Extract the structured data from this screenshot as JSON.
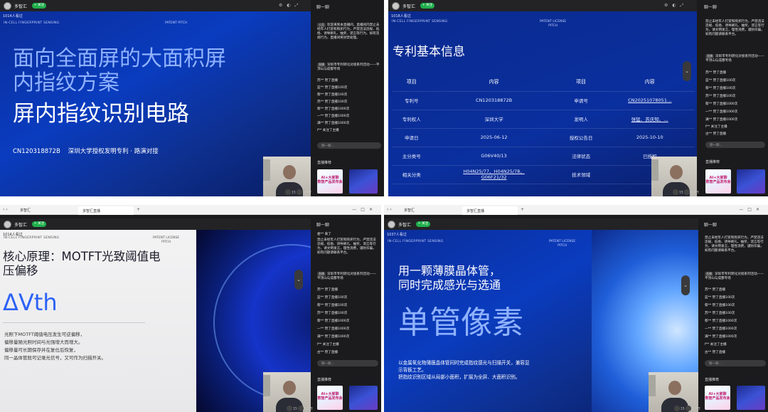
{
  "p1": {
    "streamer": "多智汇",
    "follow": "+ 关注",
    "viewers": "1014人看过",
    "tag_left": "IN-CELL FINGERPRINT SENSING",
    "tag_right": "PATENT PITCH",
    "title_line1": "面向全面屏的大面积屏",
    "title_line2": "内指纹方案",
    "title_line3": "屏内指纹识别电路",
    "footer": "CN120318872B    深圳大学授权发明专利 · 路演对接",
    "chat_header": "聊一聊",
    "stat_likes": "15",
    "stat_views": "5.7万"
  },
  "p2": {
    "streamer": "多智汇",
    "follow": "+ 关注",
    "viewers": "1018人看过",
    "tag_left": "IN-CELL FINGERPRINT SENSING",
    "tag_right": "PATENT LICENSE\nPITCH",
    "heading": "专利基本信息",
    "table_headers": [
      "项目",
      "内容",
      "项目",
      "内容"
    ],
    "table_rows": [
      [
        "专利号",
        "CN120318872B",
        "申请号",
        "CN20251078051…"
      ],
      [
        "专利权人",
        "深圳大学",
        "发明人",
        "张猛、苏庆知、…"
      ],
      [
        "申请日",
        "2025-06-12",
        "授权公告日",
        "2025-10-10"
      ],
      [
        "主分类号",
        "G06V40/13",
        "法律状态",
        "已授权"
      ],
      [
        "相关分类",
        "H04N25/77、H04N25/78、\nG06F21/32",
        "技术领域",
        ""
      ]
    ],
    "chat_header": "聊一聊",
    "stat_likes": "15",
    "stat_views": "5.7万"
  },
  "p3": {
    "tab": "多智汇直播",
    "home": "多智汇",
    "streamer": "多智汇",
    "follow": "+ 关注",
    "viewers": "1014人看过",
    "tag_left": "IN-CELL FINGERPRINT SENSING",
    "tag_right": "PATENT LICENSE\nPITCH",
    "heading_l1": "核心原理：MOTFT光致阈值电",
    "heading_l2": "压偏移",
    "big": "ΔVth",
    "desc": [
      "光照下MOTFT阈值电压发生可逆偏移，",
      "偏移量随光照时间与光强增大而增大。",
      "偏移量可长期保存并在复位后恢复，",
      "同一晶体管既可记录光信号，又可作为扫描开关。"
    ],
    "chat_header": "聊一聊",
    "stat_likes": "15",
    "stat_views": "5.7万"
  },
  "p4": {
    "tab": "多智汇直播",
    "home": "多智汇",
    "streamer": "多智汇",
    "follow": "+ 关注",
    "viewers": "1037人看过",
    "tag_left": "IN-CELL FINGERPRINT SENSING",
    "tag_right": "PATENT LICENSE\nPITCH",
    "line1": "用一颗薄膜晶体管，",
    "line2": "同时完成感光与选通",
    "big": "单管像素",
    "desc1": "以金属氧化物薄膜晶体管同时完成指纹感光与扫描开关，兼容显",
    "desc2": "示背板工艺。",
    "desc3": "把指纹识别区域从局部小面积，扩展为全屏、大面积识别。",
    "chat_header": "聊一聊",
    "stat_likes": "15",
    "stat_views": "5.7万"
  },
  "chat": {
    "notice_badge": "公告",
    "notice": "禁止未经年人打赏和购买行为，严禁违法违规、低俗、诱导刷礼、抽奖、谣言等行为，请文明发言，理性消费，谨防诈骗，如有问题请联系平台。",
    "system_badge": "直播",
    "system": "深圳市专利转化对接系列活动——平顶山与成都专场",
    "welcome": "欢迎来到本直播间，直播间内禁止未经年人打赏和购买行为，严禁违法违规、低俗、诱导刷礼、抽奖、谣言等行为，如有违规行为，直播间将封禁处理。",
    "items": [
      "君** 来了",
      "苏** 赞了直播",
      "蓝** 赞了直播100次",
      "蔡** 赞了直播100次",
      "苏** 赞了直播100次",
      "蔡** 赞了直播1000次",
      "一** 赞了直播1000次",
      "满** 赞了直播1000次",
      "f** 关注了主播",
      "古** 赞了直播"
    ],
    "reply_placeholder": "聊一聊…",
    "rec_title": "直播推荐",
    "rec1_text": "AI+大家聊\n数智产品发布会"
  }
}
